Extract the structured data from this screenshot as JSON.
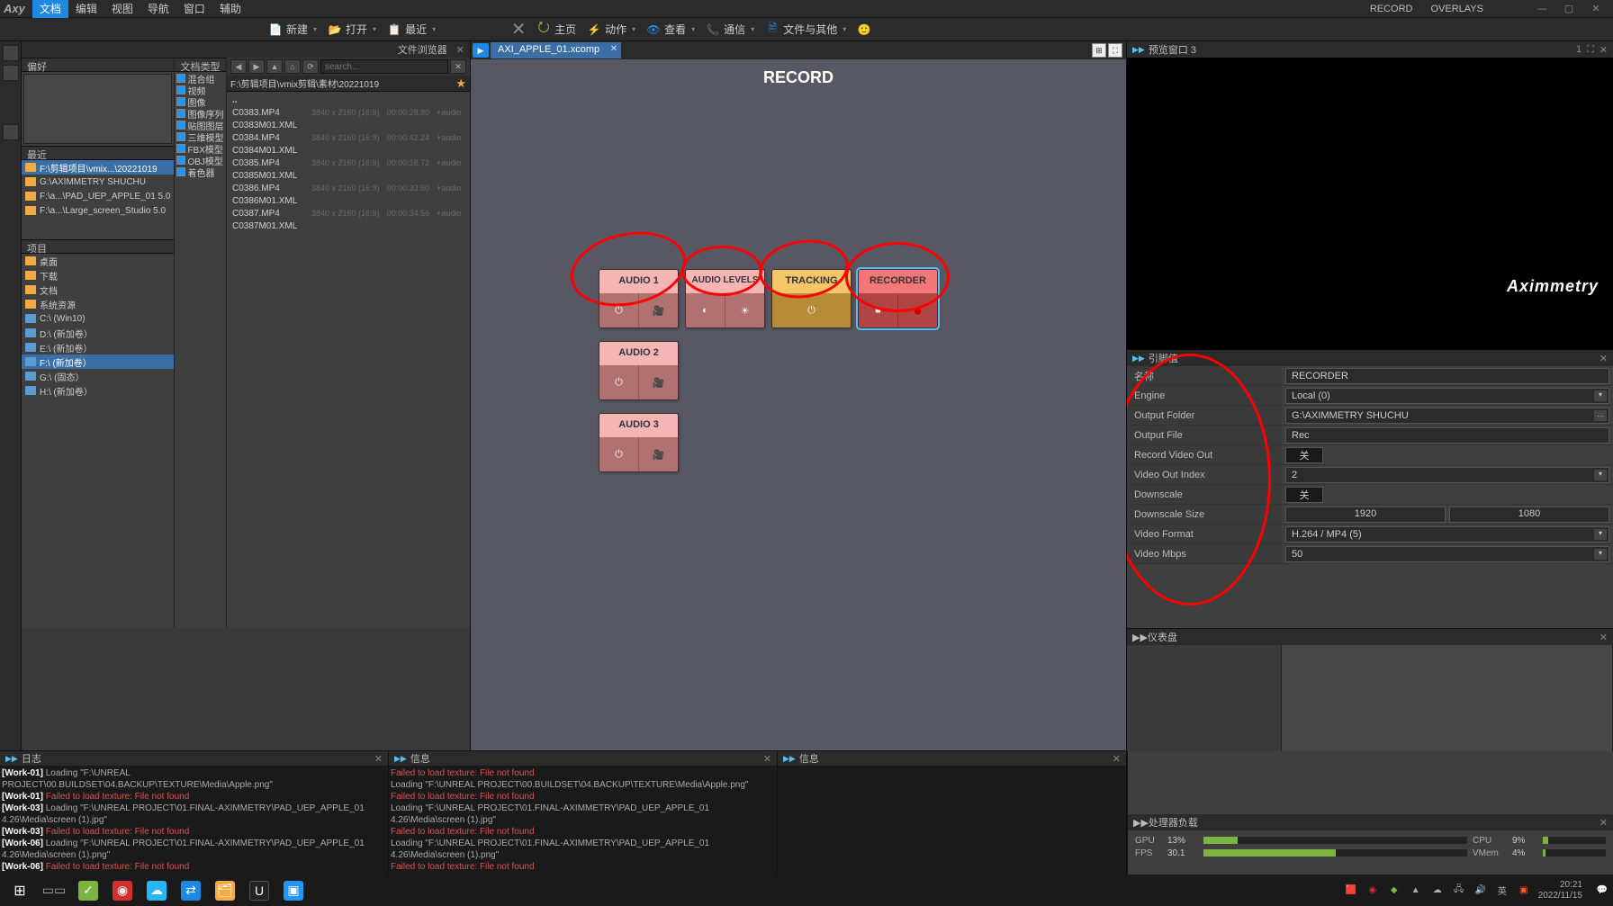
{
  "menubar": {
    "items": [
      "文档",
      "编辑",
      "视图",
      "导航",
      "窗口",
      "辅助"
    ],
    "active_index": 0,
    "right": {
      "record": "RECORD",
      "overlays": "OVERLAYS"
    }
  },
  "toolbar": {
    "new": "新建",
    "open": "打开",
    "recent": "最近",
    "close_ic": "✕",
    "home": "主页",
    "action": "动作",
    "view": "查看",
    "comm": "通信",
    "fileother": "文件与其他"
  },
  "file_explorer_title": "文件浏览器",
  "prefs_hdr": "偏好",
  "recent_hdr": "最近",
  "recent_items": [
    "F:\\剪辑项目\\vmix...\\20221019",
    "G:\\AXIMMETRY SHUCHU",
    "F:\\a...\\PAD_UEP_APPLE_01 5.0",
    "F:\\a...\\Large_screen_Studio 5.0"
  ],
  "project_hdr": "项目",
  "project_items": [
    {
      "label": "桌面",
      "type": "folder"
    },
    {
      "label": "下载",
      "type": "folder"
    },
    {
      "label": "文档",
      "type": "folder"
    },
    {
      "label": "系统资源",
      "type": "folder"
    },
    {
      "label": "C:\\  (Win10)",
      "type": "drive"
    },
    {
      "label": "D:\\  (新加卷）",
      "type": "drive"
    },
    {
      "label": "E:\\  (新加卷）",
      "type": "drive"
    },
    {
      "label": "F:\\  (新加卷）",
      "type": "drive",
      "selected": true
    },
    {
      "label": "G:\\  (固态）",
      "type": "drive"
    },
    {
      "label": "H:\\  (新加卷）",
      "type": "drive"
    }
  ],
  "types_hdr": "文档类型",
  "types": [
    "混合组",
    "视频",
    "图像",
    "图像序列",
    "贴图图层",
    "三维模型",
    "FBX模型",
    "OBJ模型",
    "着色器"
  ],
  "search_placeholder": "search...",
  "path": "F:\\剪辑项目\\vmix剪辑\\素材\\20221019",
  "files": [
    {
      "name": "..",
      "folder": true
    },
    {
      "name": "C0383.MP4",
      "res": "3840 x 2160 (16:9)",
      "dur": "00:00:28.80",
      "extra": "+audio"
    },
    {
      "name": "C0383M01.XML"
    },
    {
      "name": "C0384.MP4",
      "res": "3840 x 2160 (16:9)",
      "dur": "00:00:42.24",
      "extra": "+audio"
    },
    {
      "name": "C0384M01.XML"
    },
    {
      "name": "C0385.MP4",
      "res": "3840 x 2160 (16:9)",
      "dur": "00:00:18.72",
      "extra": "+audio"
    },
    {
      "name": "C0385M01.XML"
    },
    {
      "name": "C0386.MP4",
      "res": "3840 x 2160 (16:9)",
      "dur": "00:00:33.60",
      "extra": "+audio"
    },
    {
      "name": "C0386M01.XML"
    },
    {
      "name": "C0387.MP4",
      "res": "3840 x 2160 (16:9)",
      "dur": "00:00:34.56",
      "extra": "+audio"
    },
    {
      "name": "C0387M01.XML"
    }
  ],
  "tab_name": "AXI_APPLE_01.xcomp",
  "canvas_title": "RECORD",
  "nodes": {
    "audio1": "AUDIO 1",
    "audio_levels": "AUDIO LEVELS",
    "tracking": "TRACKING",
    "recorder": "RECORDER",
    "audio2": "AUDIO 2",
    "audio3": "AUDIO 3"
  },
  "preview": {
    "title": "预览窗口 3",
    "count": "1",
    "logo": "Aximmetry"
  },
  "pinvals": {
    "title": "引脚值",
    "rows": {
      "name_lbl": "名称",
      "name_val": "RECORDER",
      "engine_lbl": "Engine",
      "engine_val": "Local (0)",
      "outfolder_lbl": "Output Folder",
      "outfolder_val": "G:\\AXIMMETRY SHUCHU",
      "outfile_lbl": "Output File",
      "outfile_val": "Rec",
      "recvid_lbl": "Record Video Out",
      "recvid_val": "关",
      "vidx_lbl": "Video Out Index",
      "vidx_val": "2",
      "down_lbl": "Downscale",
      "down_val": "关",
      "dsize_lbl": "Downscale Size",
      "dsize_w": "1920",
      "dsize_h": "1080",
      "vfmt_lbl": "Video Format",
      "vfmt_val": "H.264 / MP4 (5)",
      "vmbps_lbl": "Video Mbps",
      "vmbps_val": "50"
    }
  },
  "dashboard_title": "仪表盘",
  "logs": {
    "left_title": "日志",
    "mid_title": "信息",
    "right_title": "信息",
    "left": [
      {
        "tag": "[Work-01]",
        "msg": " Loading \"F:\\UNREAL PROJECT\\00.BUILDSET\\04.BACKUP\\TEXTURE\\Media\\Apple.png\""
      },
      {
        "tag": "[Work-01]",
        "err": "    Failed to load texture: File not found"
      },
      {
        "tag": "[Work-03]",
        "msg": " Loading \"F:\\UNREAL PROJECT\\01.FINAL-AXIMMETRY\\PAD_UEP_APPLE_01 4.26\\Media\\screen (1).jpg\""
      },
      {
        "tag": "[Work-03]",
        "err": "    Failed to load texture: File not found"
      },
      {
        "tag": "[Work-06]",
        "msg": " Loading \"F:\\UNREAL PROJECT\\01.FINAL-AXIMMETRY\\PAD_UEP_APPLE_01 4.26\\Media\\screen (1).png\""
      },
      {
        "tag": "[Work-06]",
        "err": "    Failed to load texture: File not found"
      }
    ],
    "mid": [
      {
        "err": "    Failed to load texture: File not found"
      },
      {
        "msg": "Loading \"F:\\UNREAL PROJECT\\00.BUILDSET\\04.BACKUP\\TEXTURE\\Media\\Apple.png\""
      },
      {
        "err": "    Failed to load texture: File not found"
      },
      {
        "msg": "Loading \"F:\\UNREAL PROJECT\\01.FINAL-AXIMMETRY\\PAD_UEP_APPLE_01 4.26\\Media\\screen (1).jpg\""
      },
      {
        "err": "    Failed to load texture: File not found"
      },
      {
        "msg": "Loading \"F:\\UNREAL PROJECT\\01.FINAL-AXIMMETRY\\PAD_UEP_APPLE_01 4.26\\Media\\screen (1).png\""
      },
      {
        "err": "    Failed to load texture: File not found"
      }
    ]
  },
  "perf": {
    "title": "处理器负载",
    "gpu_lbl": "GPU",
    "gpu_val": "13%",
    "cpu_lbl": "CPU",
    "cpu_val": "9%",
    "fps_lbl": "FPS",
    "fps_val": "30.1",
    "vmem_lbl": "VMem",
    "vmem_val": "4%"
  },
  "taskbar": {
    "clock_time": "20:21",
    "clock_date": "2022/11/15"
  }
}
